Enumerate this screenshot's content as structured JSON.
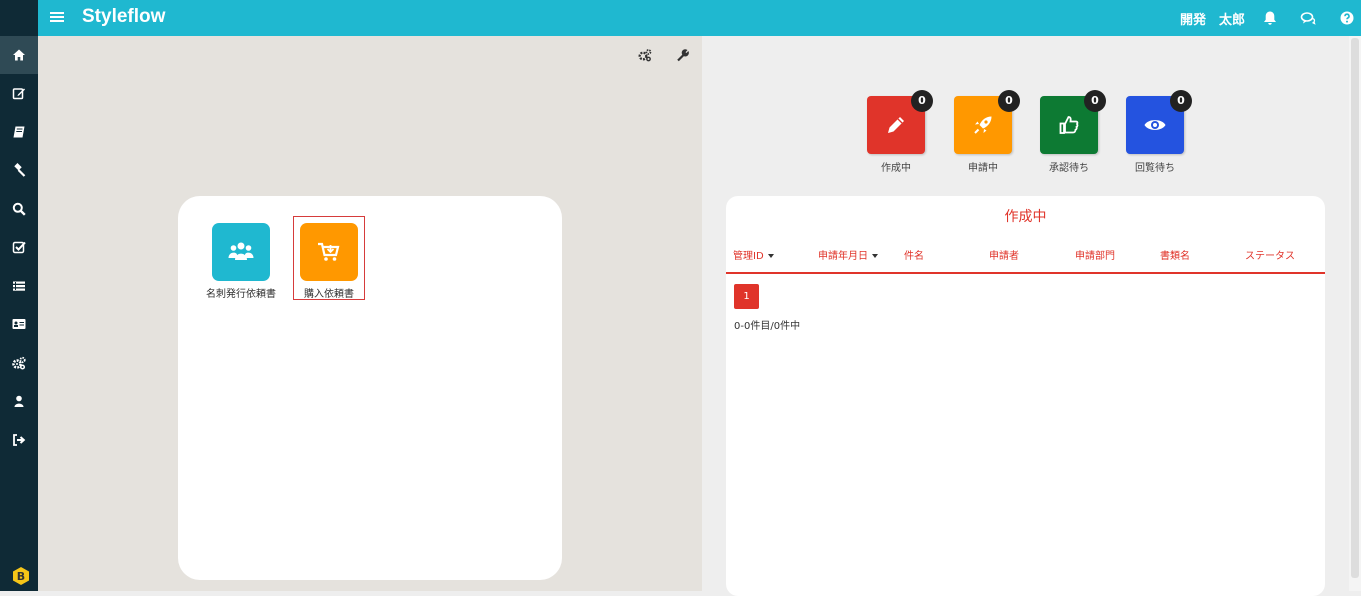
{
  "app": {
    "brand": "Styleflow",
    "user": "開発　太郎"
  },
  "sidebar": {
    "items": [
      {
        "icon": "home-icon"
      },
      {
        "icon": "edit-icon"
      },
      {
        "icon": "book-icon"
      },
      {
        "icon": "gavel-icon"
      },
      {
        "icon": "search-icon"
      },
      {
        "icon": "check-square-icon"
      },
      {
        "icon": "list-icon"
      },
      {
        "icon": "id-card-icon"
      },
      {
        "icon": "gears-icon"
      },
      {
        "icon": "user-icon"
      },
      {
        "icon": "sign-out-icon"
      }
    ],
    "badge": "B"
  },
  "forms": [
    {
      "label": "名刺発行依頼書",
      "color": "#1fb8d0",
      "icon": "users-icon"
    },
    {
      "label": "購入依頼書",
      "color": "#ff9800",
      "icon": "cart-icon"
    }
  ],
  "statuses": [
    {
      "label": "作成中",
      "count": "0",
      "color": "#e0342a",
      "icon": "pencil-icon"
    },
    {
      "label": "申請中",
      "count": "0",
      "color": "#ff9800",
      "icon": "rocket-icon"
    },
    {
      "label": "承認待ち",
      "count": "0",
      "color": "#0d7a33",
      "icon": "thumbs-up-icon"
    },
    {
      "label": "回覧待ち",
      "count": "0",
      "color": "#2453e0",
      "icon": "eye-icon"
    }
  ],
  "list": {
    "title": "作成中",
    "columns": [
      "管理ID",
      "申請年月日",
      "件名",
      "申請者",
      "申請部門",
      "書類名",
      "ステータス"
    ],
    "page": "1",
    "count_text": "0-0件目/0件中"
  }
}
